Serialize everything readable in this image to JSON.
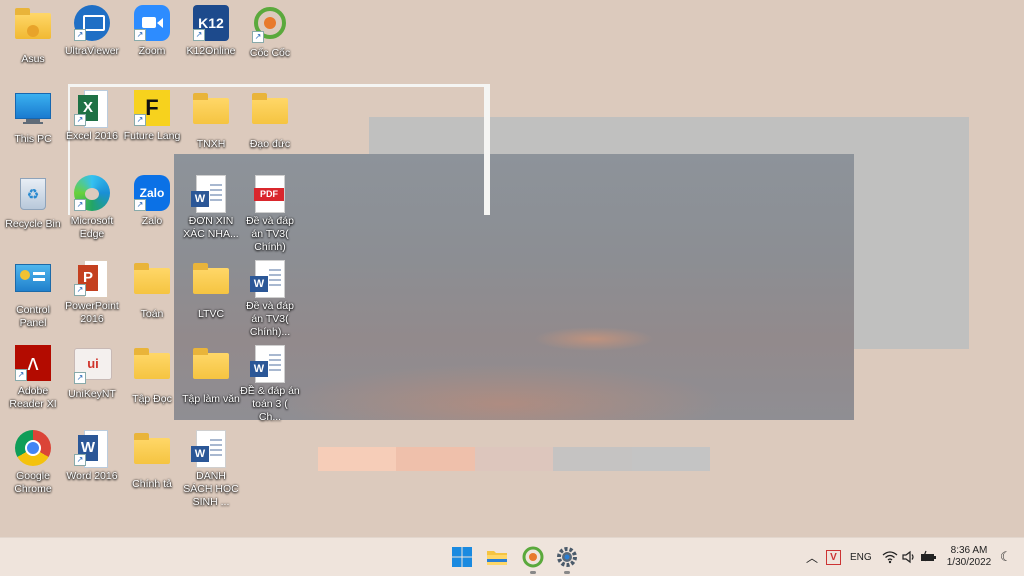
{
  "desktop": {
    "icons": [
      {
        "id": "asus",
        "label": "Asus"
      },
      {
        "id": "ultraviewer",
        "label": "UltraViewer"
      },
      {
        "id": "zoom",
        "label": "Zoom"
      },
      {
        "id": "k12online",
        "label": "K12Online"
      },
      {
        "id": "coccoc",
        "label": "Cốc Cốc"
      },
      {
        "id": "thispc",
        "label": "This PC"
      },
      {
        "id": "excel",
        "label": "Excel 2016"
      },
      {
        "id": "futurelang",
        "label": "Future Lang"
      },
      {
        "id": "tnxh",
        "label": "TNXH"
      },
      {
        "id": "daoduc",
        "label": "Đạo đức"
      },
      {
        "id": "recyclebin",
        "label": "Recycle Bin"
      },
      {
        "id": "edge",
        "label": "Microsoft Edge"
      },
      {
        "id": "zalo",
        "label": "Zalo"
      },
      {
        "id": "donxin",
        "label": "ĐƠN XIN XÁC NHA..."
      },
      {
        "id": "pdf-de",
        "label": "Đề và đáp án TV3( Chính)"
      },
      {
        "id": "controlpanel",
        "label": "Control Panel"
      },
      {
        "id": "powerpoint",
        "label": "PowerPoint 2016"
      },
      {
        "id": "toan",
        "label": "Toán"
      },
      {
        "id": "ltvc",
        "label": "LTVC"
      },
      {
        "id": "doc-de",
        "label": "Đề và đáp án TV3( Chính)..."
      },
      {
        "id": "adobe",
        "label": "Adobe Reader XI"
      },
      {
        "id": "unikey",
        "label": "UniKeyNT"
      },
      {
        "id": "tapdoc",
        "label": "Tập Đọc"
      },
      {
        "id": "taplamvan",
        "label": "Tập làm văn"
      },
      {
        "id": "de-toan",
        "label": "ĐỀ & đáp án toán 3 ( Ch..."
      },
      {
        "id": "chrome",
        "label": "Google Chrome"
      },
      {
        "id": "word",
        "label": "Word 2016"
      },
      {
        "id": "chinhta",
        "label": "Chính tả"
      },
      {
        "id": "danhsach",
        "label": "DANH SÁCH HỌC SINH ..."
      }
    ],
    "glyph_text": {
      "k12": "K12",
      "excel": "X",
      "future": "F",
      "zalo": "Zalo",
      "pdf": "PDF",
      "word": "W",
      "ppt": "P",
      "unikey": "ui"
    }
  },
  "taskbar": {
    "tray": {
      "language": "ENG",
      "time": "8:36 AM",
      "date": "1/30/2022"
    }
  },
  "colors": {
    "desktop_bg": "#dccabd",
    "taskbar_bg": "#efe4dc",
    "word_blue": "#2b5797",
    "excel_green": "#1e7145",
    "folder_yellow": "#f5c441"
  }
}
